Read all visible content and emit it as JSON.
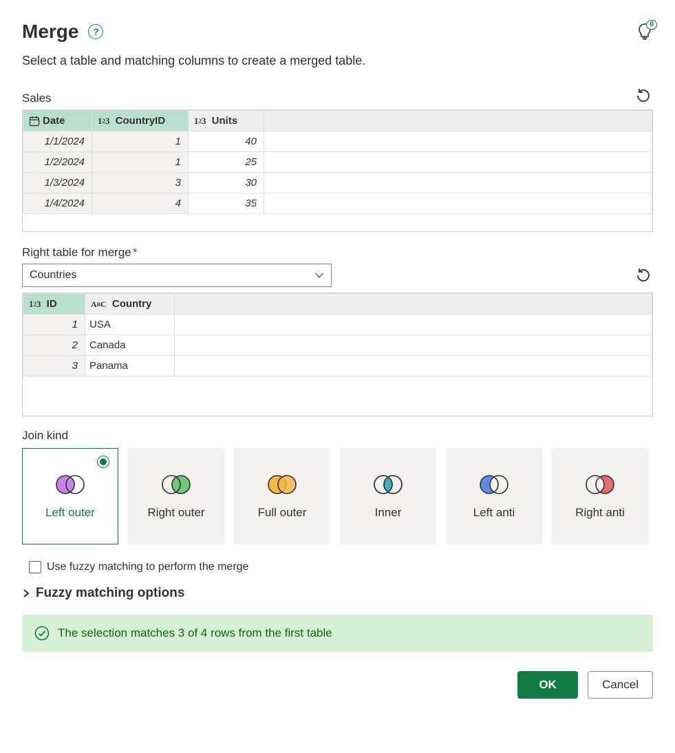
{
  "header": {
    "title": "Merge",
    "subtitle": "Select a table and matching columns to create a merged table.",
    "tips_badge": "0"
  },
  "left_table": {
    "name": "Sales",
    "columns": [
      {
        "name": "Date",
        "type": "date",
        "selected": true
      },
      {
        "name": "CountryID",
        "type": "number",
        "selected": true
      },
      {
        "name": "Units",
        "type": "number",
        "selected": false
      }
    ],
    "rows": [
      {
        "date": "1/1/2024",
        "countryid": "1",
        "units": "40"
      },
      {
        "date": "1/2/2024",
        "countryid": "1",
        "units": "25"
      },
      {
        "date": "1/3/2024",
        "countryid": "3",
        "units": "30"
      },
      {
        "date": "1/4/2024",
        "countryid": "4",
        "units": "35"
      }
    ]
  },
  "right_picker": {
    "label": "Right table for merge",
    "selected": "Countries"
  },
  "right_table": {
    "columns": [
      {
        "name": "ID",
        "type": "number",
        "selected": true
      },
      {
        "name": "Country",
        "type": "text",
        "selected": false
      }
    ],
    "rows": [
      {
        "id": "1",
        "country": "USA"
      },
      {
        "id": "2",
        "country": "Canada"
      },
      {
        "id": "3",
        "country": "Panama"
      }
    ]
  },
  "join": {
    "label": "Join kind",
    "options": [
      {
        "key": "left-outer",
        "label": "Left outer",
        "selected": true
      },
      {
        "key": "right-outer",
        "label": "Right outer",
        "selected": false
      },
      {
        "key": "full-outer",
        "label": "Full outer",
        "selected": false
      },
      {
        "key": "inner",
        "label": "Inner",
        "selected": false
      },
      {
        "key": "left-anti",
        "label": "Left anti",
        "selected": false
      },
      {
        "key": "right-anti",
        "label": "Right anti",
        "selected": false
      }
    ]
  },
  "fuzzy": {
    "checkbox_label": "Use fuzzy matching to perform the merge",
    "expander_label": "Fuzzy matching options"
  },
  "status": {
    "text": "The selection matches 3 of 4 rows from the first table"
  },
  "footer": {
    "ok": "OK",
    "cancel": "Cancel"
  }
}
